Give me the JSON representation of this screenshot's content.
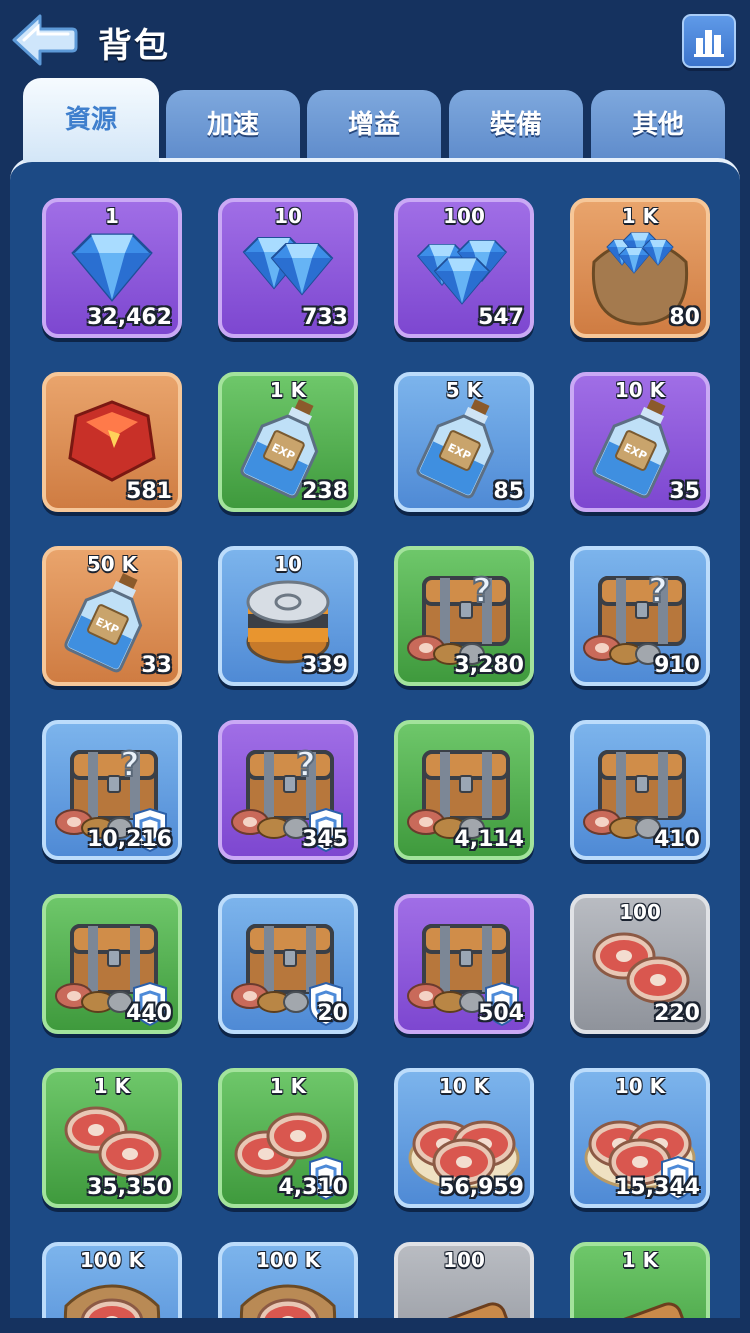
{
  "header": {
    "title": "背包",
    "back_icon": "back-arrow-icon",
    "stats_icon": "bar-chart-icon"
  },
  "tabs": [
    {
      "label": "資源",
      "active": true
    },
    {
      "label": "加速",
      "active": false
    },
    {
      "label": "增益",
      "active": false
    },
    {
      "label": "裝備",
      "active": false
    },
    {
      "label": "其他",
      "active": false
    }
  ],
  "items": [
    {
      "icon": "diamond-icon",
      "amount": "1",
      "count": "32,462",
      "rarity": "purple"
    },
    {
      "icon": "gems-icon",
      "amount": "10",
      "count": "733",
      "rarity": "purple"
    },
    {
      "icon": "gem-pile-icon",
      "amount": "100",
      "count": "547",
      "rarity": "purple"
    },
    {
      "icon": "gem-sack-icon",
      "amount": "1 K",
      "count": "80",
      "rarity": "orange"
    },
    {
      "icon": "red-crystal-icon",
      "amount": "",
      "count": "581",
      "rarity": "orange"
    },
    {
      "icon": "exp-bottle-icon",
      "amount": "1 K",
      "count": "238",
      "rarity": "green"
    },
    {
      "icon": "exp-bottle-icon",
      "amount": "5 K",
      "count": "85",
      "rarity": "blue"
    },
    {
      "icon": "exp-bottle-icon",
      "amount": "10 K",
      "count": "35",
      "rarity": "purple"
    },
    {
      "icon": "exp-bottle-icon",
      "amount": "50 K",
      "count": "33",
      "rarity": "orange"
    },
    {
      "icon": "can-icon",
      "amount": "10",
      "count": "339",
      "rarity": "blue"
    },
    {
      "icon": "mystery-chest-icon",
      "amount": "",
      "count": "3,280",
      "rarity": "green"
    },
    {
      "icon": "mystery-chest-icon",
      "amount": "",
      "count": "910",
      "rarity": "blue"
    },
    {
      "icon": "mystery-chest-shield-icon",
      "amount": "",
      "count": "10,216",
      "rarity": "blue"
    },
    {
      "icon": "mystery-chest-shield-icon",
      "amount": "",
      "count": "345",
      "rarity": "purple"
    },
    {
      "icon": "resource-chest-icon",
      "amount": "",
      "count": "4,114",
      "rarity": "green"
    },
    {
      "icon": "resource-chest-icon",
      "amount": "",
      "count": "410",
      "rarity": "blue"
    },
    {
      "icon": "resource-chest-shield-icon",
      "amount": "",
      "count": "440",
      "rarity": "green"
    },
    {
      "icon": "resource-chest-shield-icon",
      "amount": "",
      "count": "20",
      "rarity": "blue"
    },
    {
      "icon": "resource-chest-shield-icon",
      "amount": "",
      "count": "504",
      "rarity": "purple"
    },
    {
      "icon": "meat-icon",
      "amount": "100",
      "count": "220",
      "rarity": "gray"
    },
    {
      "icon": "meat-icon",
      "amount": "1 K",
      "count": "35,350",
      "rarity": "green"
    },
    {
      "icon": "meat-shield-icon",
      "amount": "1 K",
      "count": "4,310",
      "rarity": "green"
    },
    {
      "icon": "meat-plate-icon",
      "amount": "10 K",
      "count": "56,959",
      "rarity": "blue"
    },
    {
      "icon": "meat-plate-shield-icon",
      "amount": "10 K",
      "count": "15,344",
      "rarity": "blue"
    },
    {
      "icon": "meat-sack-icon",
      "amount": "100 K",
      "count": "",
      "rarity": "blue"
    },
    {
      "icon": "meat-sack-icon",
      "amount": "100 K",
      "count": "",
      "rarity": "blue"
    },
    {
      "icon": "wood-icon",
      "amount": "100",
      "count": "",
      "rarity": "gray"
    },
    {
      "icon": "wood-logs-icon",
      "amount": "1 K",
      "count": "",
      "rarity": "green"
    }
  ]
}
